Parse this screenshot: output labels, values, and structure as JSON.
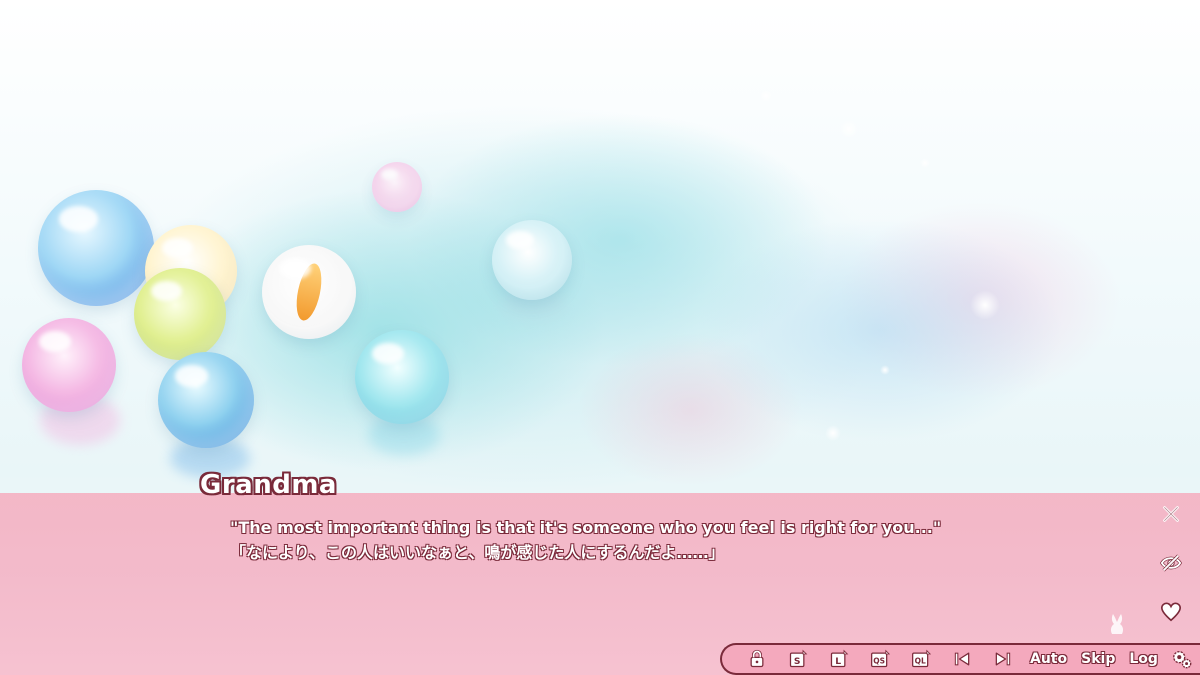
{
  "dialogue": {
    "speaker": "Grandma",
    "line_en": "\"The most important thing is that it's someone who you feel is right for you...\"",
    "line_jp": "「なにより、この人はいいなぁと、鳴が感じた人にするんだよ……」"
  },
  "side_controls": [
    {
      "icon": "close-icon"
    },
    {
      "icon": "eye-off-icon"
    },
    {
      "icon": "heart-icon"
    }
  ],
  "menu": {
    "icons": [
      "lock-icon",
      "save-icon",
      "load-icon",
      "quick-save-icon",
      "quick-load-icon",
      "previous-icon",
      "next-icon"
    ],
    "auto_label": "Auto",
    "skip_label": "Skip",
    "log_label": "Log",
    "settings_icon": "gear-icon"
  },
  "colors": {
    "textbox": "#f3b2c4",
    "outline": "#7a2a3a",
    "text": "#ffffff"
  }
}
